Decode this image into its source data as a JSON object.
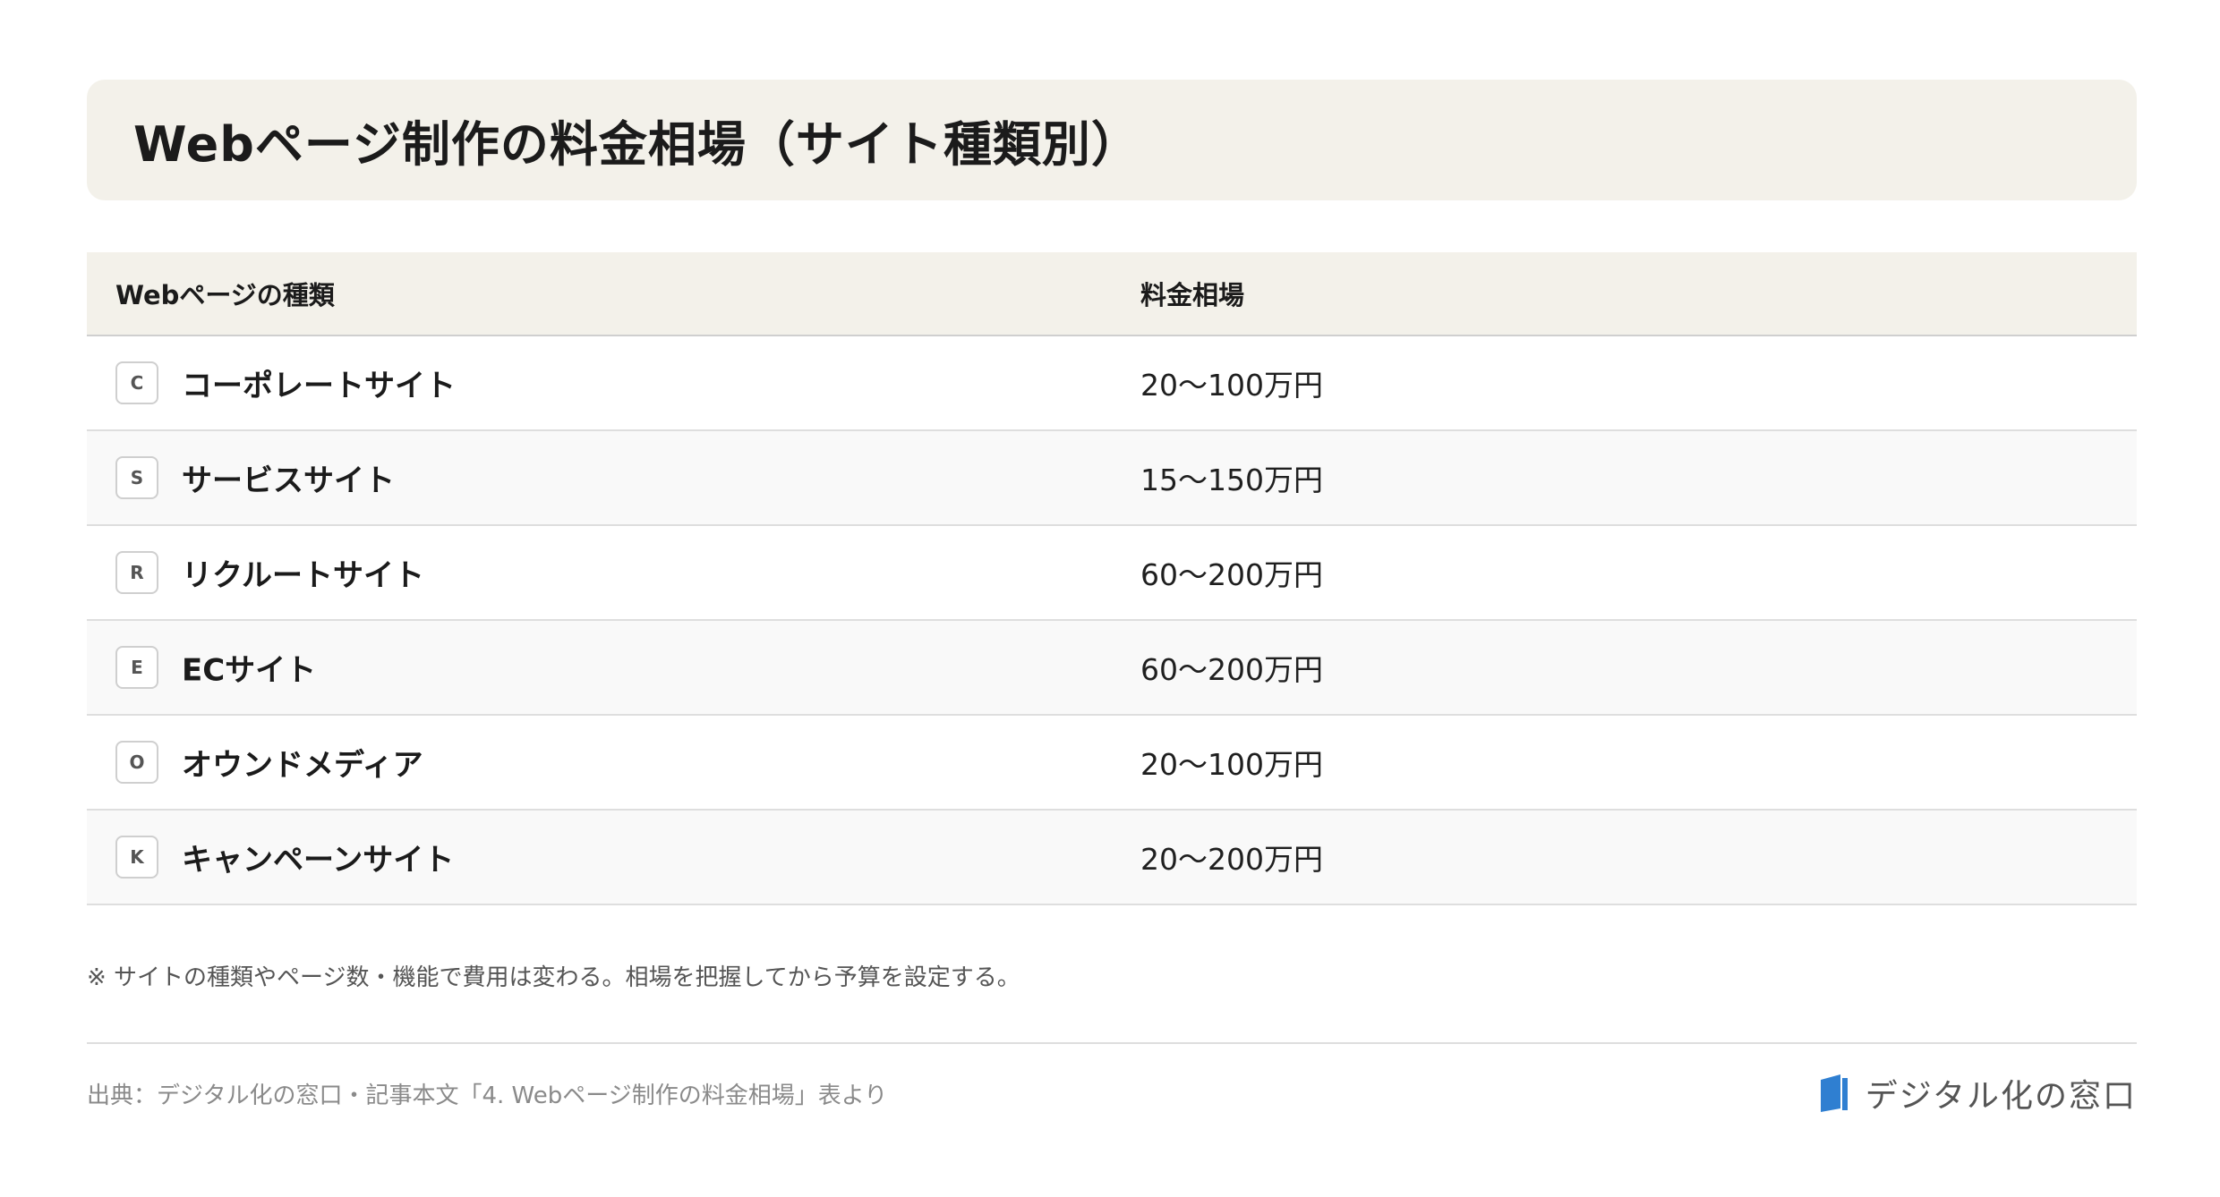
{
  "title": "Webページ制作の料金相場（サイト種類別）",
  "table": {
    "headers": {
      "type": "Webページの種類",
      "price": "料金相場"
    },
    "rows": [
      {
        "badge": "C",
        "name": "コーポレートサイト",
        "price": "20〜100万円"
      },
      {
        "badge": "S",
        "name": "サービスサイト",
        "price": "15〜150万円"
      },
      {
        "badge": "R",
        "name": "リクルートサイト",
        "price": "60〜200万円"
      },
      {
        "badge": "E",
        "name": "ECサイト",
        "price": "60〜200万円"
      },
      {
        "badge": "O",
        "name": "オウンドメディア",
        "price": "20〜100万円"
      },
      {
        "badge": "K",
        "name": "キャンペーンサイト",
        "price": "20〜200万円"
      }
    ]
  },
  "note": "※ サイトの種類やページ数・機能で費用は変わる。相場を把握してから予算を設定する。",
  "source": "出典：デジタル化の窓口・記事本文「4. Webページ制作の料金相場」表より",
  "logo": {
    "text": "デジタル化の窓口",
    "icon": "book-logo-icon",
    "color": "#2f7fd1"
  }
}
